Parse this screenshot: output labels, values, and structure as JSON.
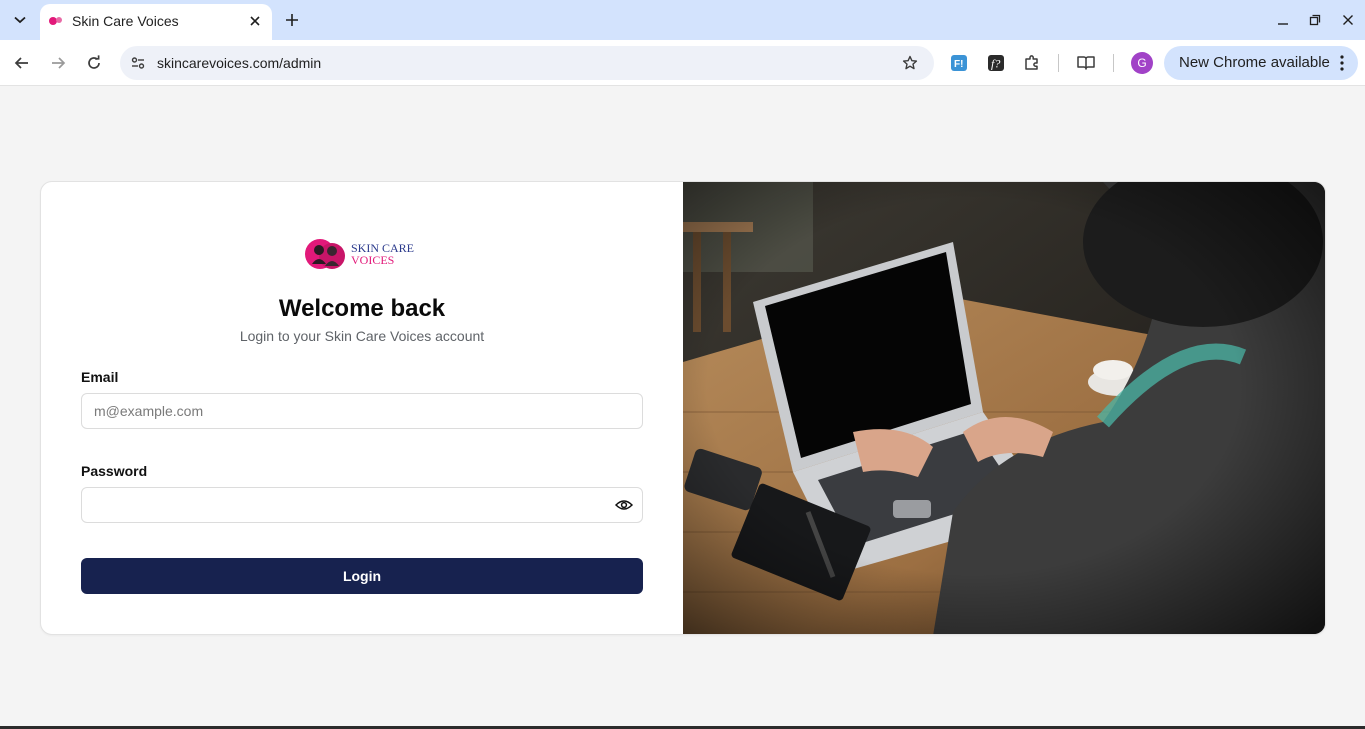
{
  "browser": {
    "tab_title": "Skin Care Voices",
    "url": "skincarevoices.com/admin",
    "profile_initial": "G",
    "update_label": "New Chrome available",
    "extension_icons": [
      "feedly-icon",
      "formula-icon",
      "puzzle-extensions-icon",
      "reading-list-icon"
    ]
  },
  "page": {
    "logo_text": [
      "SKIN CARE",
      "VOICES"
    ],
    "heading": "Welcome back",
    "subheading": "Login to your Skin Care Voices account",
    "email": {
      "label": "Email",
      "placeholder": "m@example.com",
      "value": ""
    },
    "password": {
      "label": "Password",
      "value": ""
    },
    "login_label": "Login"
  },
  "colors": {
    "tabbar": "#d3e3fd",
    "page_bg": "#f4f4f4",
    "button": "#17224f",
    "logo_pink": "#e2197a",
    "logo_navy": "#2b3a8c",
    "avatar": "#a142c7"
  }
}
